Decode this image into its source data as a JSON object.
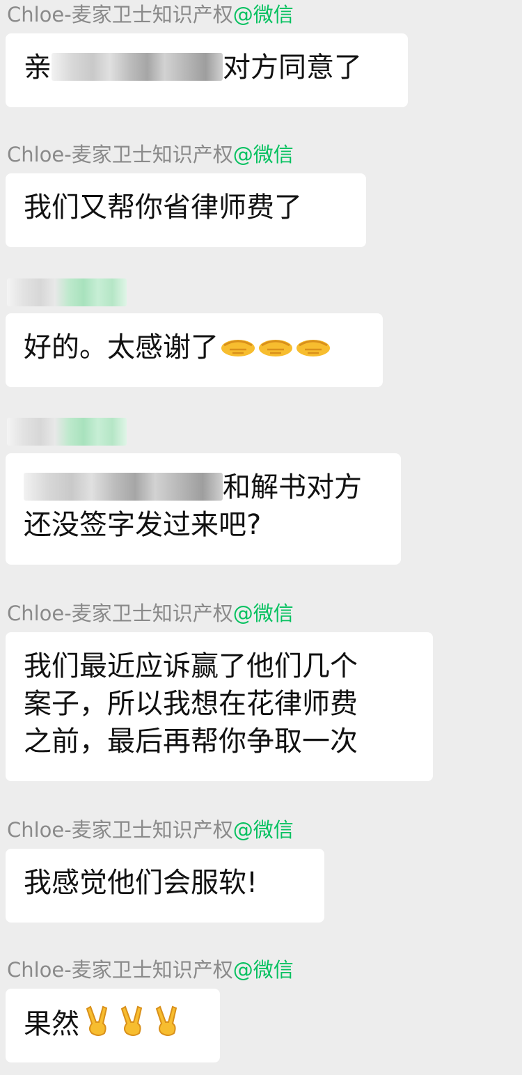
{
  "messages": [
    {
      "sender": {
        "name": "Chloe-麦家卫士知识产权",
        "app": "@微信"
      },
      "lines": [
        {
          "before": "亲",
          "after": "对方同意了"
        }
      ]
    },
    {
      "sender": {
        "name": "Chloe-麦家卫士知识产权",
        "app": "@微信"
      },
      "lines": [
        {
          "text": "我们又帮你省律师费了"
        }
      ]
    },
    {
      "sender": null,
      "lines": [
        {
          "text": "好的。太感谢了"
        }
      ],
      "emoji": {
        "icon": "handshake-icon",
        "count": 3
      }
    },
    {
      "sender": null,
      "lines": [
        {
          "after": "和解书对方"
        },
        {
          "text": "还没签字发过来吧?"
        }
      ]
    },
    {
      "sender": {
        "name": "Chloe-麦家卫士知识产权",
        "app": "@微信"
      },
      "lines": [
        {
          "text": "我们最近应诉赢了他们几个"
        },
        {
          "text": "案子，所以我想在花律师费"
        },
        {
          "text": "之前，最后再帮你争取一次"
        }
      ]
    },
    {
      "sender": {
        "name": "Chloe-麦家卫士知识产权",
        "app": "@微信"
      },
      "lines": [
        {
          "text": "我感觉他们会服软!"
        }
      ]
    },
    {
      "sender": {
        "name": "Chloe-麦家卫士知识产权",
        "app": "@微信"
      },
      "lines": [
        {
          "text": "果然"
        }
      ],
      "emoji": {
        "icon": "victory-hand-icon",
        "count": 3
      }
    }
  ],
  "colors": {
    "background": "#ededed",
    "bubble": "#ffffff",
    "sender_name": "#8a8a8a",
    "app_tag": "#07c160",
    "message_text": "#111111",
    "emoji_yellow": "#f7bd2f"
  }
}
